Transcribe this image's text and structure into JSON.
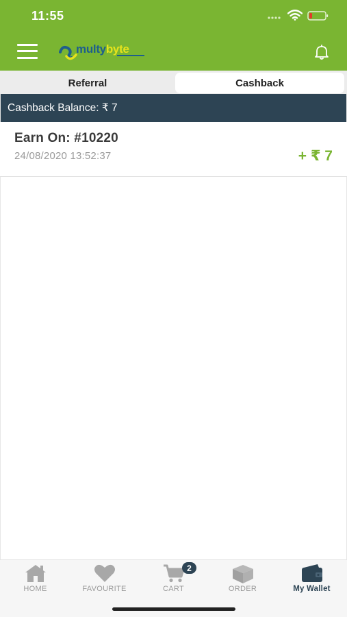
{
  "status_bar": {
    "time": "11:55",
    "icons": [
      "cellular-signal-icon",
      "wifi-icon",
      "battery-low-icon"
    ]
  },
  "app_bar": {
    "logo_text_part1": "multy",
    "logo_text_part2": "byte",
    "icons": [
      "hamburger-menu-icon",
      "bell-icon"
    ]
  },
  "tabs": [
    {
      "label": "Referral",
      "active": false
    },
    {
      "label": "Cashback",
      "active": true
    }
  ],
  "balance": {
    "text": "Cashback Balance: ₹ 7"
  },
  "transactions": [
    {
      "title": "Earn On: #10220",
      "date": "24/08/2020 13:52:37",
      "amount": "+ ₹ 7"
    }
  ],
  "bottom_nav": {
    "items": [
      {
        "label": "HOME",
        "icon": "home-icon",
        "active": false
      },
      {
        "label": "FAVOURITE",
        "icon": "heart-icon",
        "active": false
      },
      {
        "label": "CART",
        "icon": "cart-icon",
        "active": false,
        "badge": "2"
      },
      {
        "label": "ORDER",
        "icon": "box-icon",
        "active": false
      },
      {
        "label": "My Wallet",
        "icon": "wallet-icon",
        "active": true
      }
    ]
  },
  "colors": {
    "brand_green": "#7ab532",
    "dark_navy": "#2d4454",
    "logo_blue": "#1e5f8c",
    "logo_yellow": "#e6e21c"
  }
}
